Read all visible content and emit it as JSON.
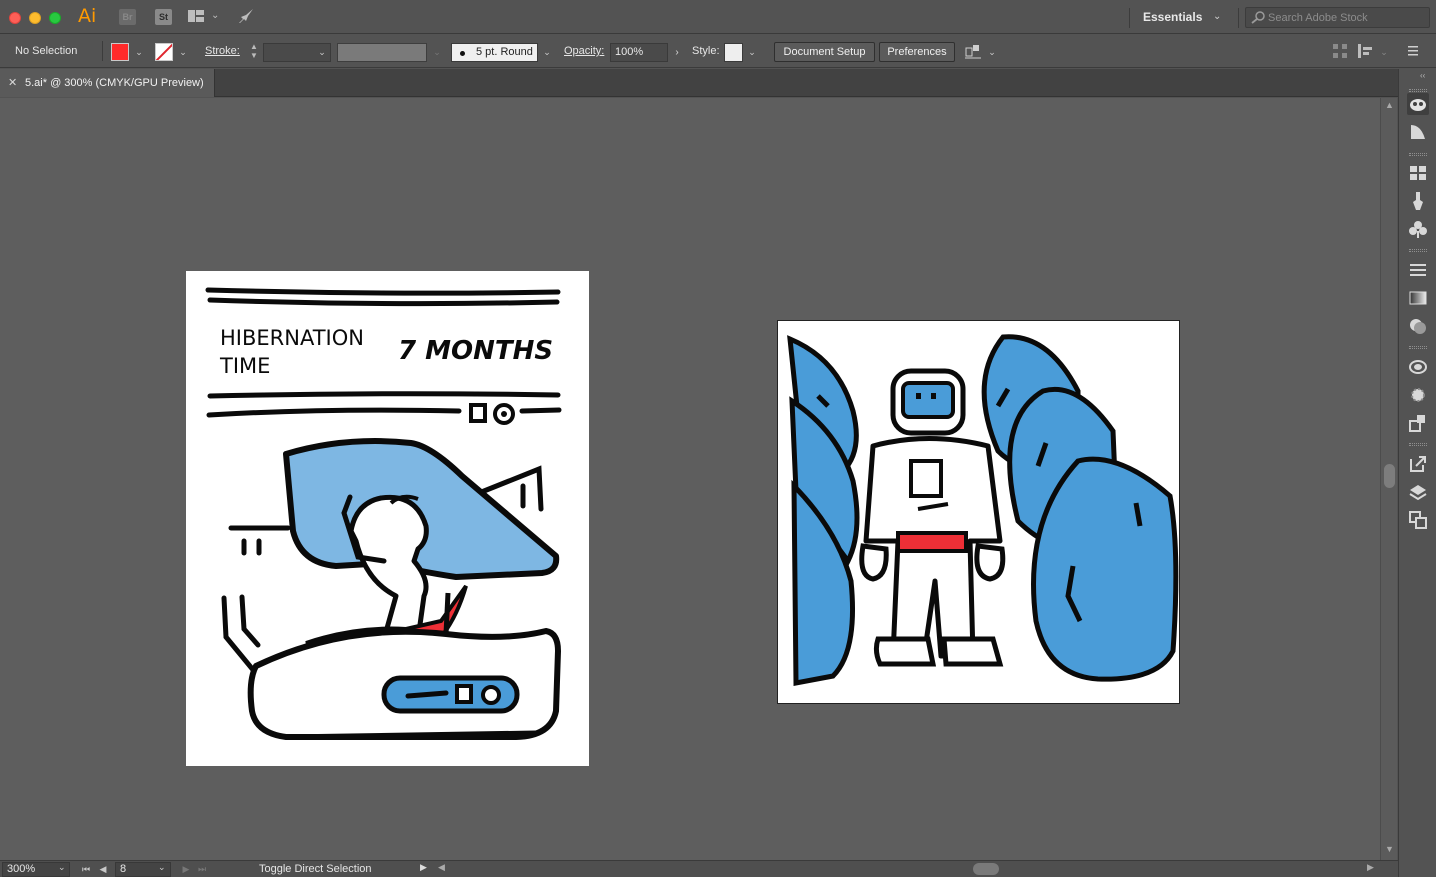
{
  "app": {
    "logo": "Ai",
    "bridge_label": "Br",
    "stock_label": "St",
    "workspace": "Essentials",
    "search_placeholder": "Search Adobe Stock"
  },
  "control_bar": {
    "selection_status": "No Selection",
    "fill_color": "#ff2a2a",
    "stroke_label": "Stroke:",
    "stroke_weight": "",
    "brush": "5 pt. Round",
    "opacity_label": "Opacity:",
    "opacity_value": "100%",
    "style_label": "Style:",
    "document_setup": "Document Setup",
    "preferences": "Preferences"
  },
  "document": {
    "tab_title": "5.ai* @ 300% (CMYK/GPU Preview)"
  },
  "artwork": {
    "artboard1": {
      "heading": "HIBERNATION",
      "heading2": "TIME",
      "months": "7 MONTHS"
    },
    "colors": {
      "blue": "#4a9cd8",
      "light_blue": "#7eb7e3",
      "red": "#ee2f36",
      "ink": "#0a0a0a"
    }
  },
  "status_bar": {
    "zoom": "300%",
    "artboard_number": "8",
    "status_text": "Toggle Direct Selection"
  },
  "dock_icons": [
    "cc-libraries-icon",
    "image-trace-icon",
    "swatches-icon",
    "brushes-icon",
    "symbols-icon",
    "stroke-icon",
    "gradient-icon",
    "transparency-icon",
    "color-themes-icon",
    "appearance-icon",
    "graphic-styles-icon",
    "export-icon",
    "layers-icon",
    "artboards-icon"
  ]
}
